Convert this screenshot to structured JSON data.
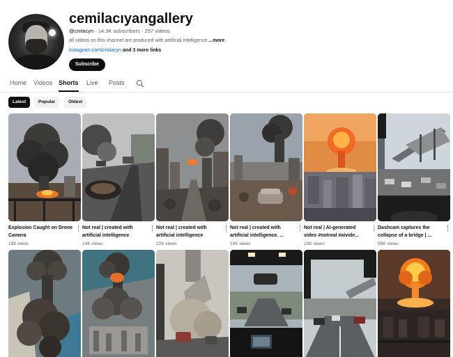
{
  "channel": {
    "title": "cemilacıyangallery",
    "handle": "@cmlacyn",
    "subscribers": "14.3K subscribers",
    "videos": "257 videos",
    "separator": "·",
    "description": "all videos on this channel are produced with artificial intelligence",
    "description_more": "...more",
    "link": "instagram.com/cmilacyn",
    "more_links": "and 3 more links",
    "subscribe_label": "Subscribe"
  },
  "tabs": [
    {
      "label": "Home",
      "active": false
    },
    {
      "label": "Videos",
      "active": false
    },
    {
      "label": "Shorts",
      "active": true
    },
    {
      "label": "Live",
      "active": false
    },
    {
      "label": "Posts",
      "active": false
    }
  ],
  "chips": [
    {
      "label": "Latest",
      "active": true
    },
    {
      "label": "Popular",
      "active": false
    },
    {
      "label": "Oldest",
      "active": false
    }
  ],
  "shorts": [
    {
      "title": "Explosion Caught on Drone Camera",
      "views": "159 views",
      "scene": "smoke-fire"
    },
    {
      "title": "Not real | created with artificial intelligence",
      "views": "14K views",
      "scene": "road-crater"
    },
    {
      "title": "Not real | created with artificial intelligence",
      "views": "22K views",
      "scene": "city-ruins"
    },
    {
      "title": "Not real | created with artificial intelligence. ...",
      "views": "10K views",
      "scene": "city-plume"
    },
    {
      "title": "Not real | AI-generated video #notreal #aivide...",
      "views": "15K views",
      "scene": "nuclear-dusk"
    },
    {
      "title": "Dashcam captures the collapse of a bridge | ...",
      "views": "55K views",
      "scene": "bridge-collapse"
    },
    {
      "title": "",
      "views": "",
      "scene": "coast-mushroom"
    },
    {
      "title": "",
      "views": "",
      "scene": "harbor-mushroom"
    },
    {
      "title": "",
      "views": "",
      "scene": "tower-fall"
    },
    {
      "title": "",
      "views": "",
      "scene": "dashcam-highway"
    },
    {
      "title": "",
      "views": "",
      "scene": "dashcam-bridge"
    },
    {
      "title": "",
      "views": "",
      "scene": "nuclear-night"
    }
  ],
  "icons": {
    "search": "search-icon",
    "kebab": "more-vert-icon",
    "kebab_glyph": "⋮"
  }
}
